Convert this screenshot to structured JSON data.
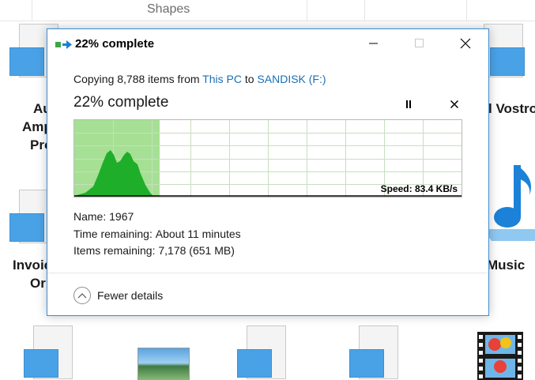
{
  "background": {
    "header_label": "Shapes",
    "items": [
      {
        "label_lines": [
          "Au",
          "Amp",
          "Pro"
        ]
      },
      {
        "label_lines": [
          "Invoic",
          "Or"
        ]
      },
      {
        "label_lines": [
          "l Vostro"
        ]
      },
      {
        "label_lines": [
          "Music"
        ]
      }
    ]
  },
  "dialog": {
    "title": "22% complete",
    "window_buttons": {
      "minimize": "minimize",
      "maximize": "maximize",
      "close": "close"
    },
    "copy": {
      "prefix": "Copying 8,788 items from ",
      "source": "This PC",
      "middle": " to ",
      "destination": "SANDISK (F:)"
    },
    "progress_heading": "22% complete",
    "progress_fraction": 0.22,
    "speed": "Speed: 83.4 KB/s",
    "details": {
      "name_label": "Name:",
      "name_value": "1967",
      "time_label": "Time remaining:",
      "time_value": "About 11 minutes",
      "items_label": "Items remaining:",
      "items_value": "7,178 (651 MB)"
    },
    "toggle_label": "Fewer details"
  },
  "colors": {
    "accent": "#1a6fb5",
    "progress_fill": "#a6e094",
    "speed_area": "#1fae2a",
    "grid": "#c7dfc0"
  }
}
